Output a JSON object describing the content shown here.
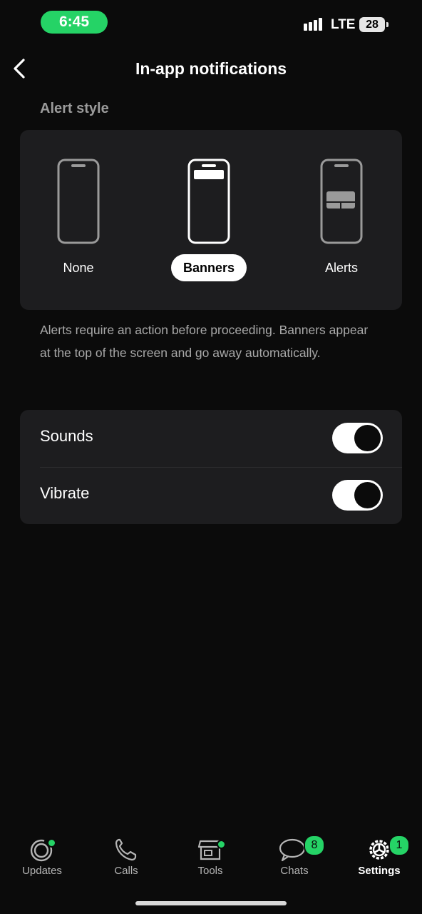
{
  "status_bar": {
    "time": "6:45",
    "network": "LTE",
    "battery": "28"
  },
  "header": {
    "title": "In-app notifications"
  },
  "alert_style": {
    "section_label": "Alert style",
    "options": [
      {
        "label": "None",
        "selected": false
      },
      {
        "label": "Banners",
        "selected": true
      },
      {
        "label": "Alerts",
        "selected": false
      }
    ],
    "description": "Alerts require an action before proceeding. Banners appear at the top of the screen and go away automatically."
  },
  "settings": [
    {
      "label": "Sounds",
      "enabled": true
    },
    {
      "label": "Vibrate",
      "enabled": true
    }
  ],
  "tab_bar": {
    "tabs": [
      {
        "label": "Updates",
        "icon": "updates-icon"
      },
      {
        "label": "Calls",
        "icon": "phone-icon"
      },
      {
        "label": "Tools",
        "icon": "store-icon"
      },
      {
        "label": "Chats",
        "icon": "chat-icon",
        "badge": "8"
      },
      {
        "label": "Settings",
        "icon": "gear-icon",
        "badge": "1",
        "active": true
      }
    ]
  },
  "colors": {
    "accent": "#25d366",
    "background": "#0b0b0b",
    "card": "#1d1d1f"
  }
}
